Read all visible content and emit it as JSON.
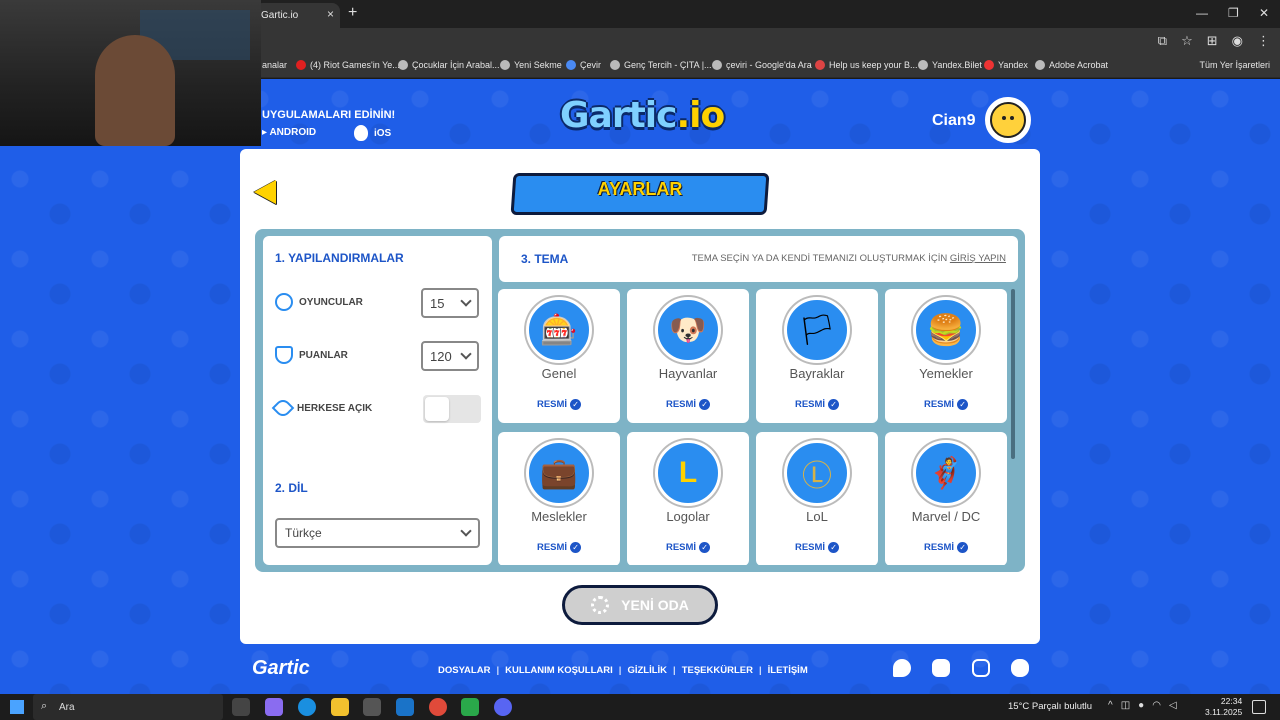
{
  "browser": {
    "tab_title": "Gartic.io",
    "tab_close": "×",
    "new_tab": "+",
    "window_controls": [
      "—",
      "❐",
      "✕"
    ],
    "bookmarks": [
      "analar",
      "(4) Riot Games'in Ye...",
      "Çocuklar İçin Arabal...",
      "Yeni Sekme",
      "Çevir",
      "Genç Tercih - ÇITA |...",
      "çeviri - Google'da Ara",
      "Help us keep your B...",
      "Yandex.Bilet",
      "Yandex",
      "Adobe Acrobat"
    ],
    "all_bookmarks": "Tüm Yer İşaretleri"
  },
  "header": {
    "apps_title": "UYGULAMALARI EDİNİN!",
    "android": "ANDROID",
    "ios": "iOS",
    "logo_main": "Gartic",
    "logo_io": ".io",
    "username": "Cian9"
  },
  "settings": {
    "title": "AYARLAR",
    "config_title": "1. YAPILANDIRMALAR",
    "players_label": "OYUNCULAR",
    "players_value": "15",
    "points_label": "PUANLAR",
    "points_value": "120",
    "public_label": "HERKESE AÇIK",
    "public_on": false,
    "language_title": "2. DİL",
    "language_value": "Türkçe",
    "theme_title": "3. TEMA",
    "theme_hint": "TEMA SEÇİN YA DA KENDİ TEMANIZI OLUŞTURMAK İÇİN ",
    "theme_hint_link": "GİRİŞ YAPIN",
    "themes": [
      {
        "name": "Genel",
        "badge": "RESMİ",
        "icon": "slot-machine-icon",
        "glyph": "🎰"
      },
      {
        "name": "Hayvanlar",
        "badge": "RESMİ",
        "icon": "dog-icon",
        "glyph": "🐶"
      },
      {
        "name": "Bayraklar",
        "badge": "RESMİ",
        "icon": "flag-icon",
        "glyph": "🏳"
      },
      {
        "name": "Yemekler",
        "badge": "RESMİ",
        "icon": "burger-icon",
        "glyph": "🍔"
      },
      {
        "name": "Meslekler",
        "badge": "RESMİ",
        "icon": "briefcase-icon",
        "glyph": "💼"
      },
      {
        "name": "Logolar",
        "badge": "RESMİ",
        "icon": "logo-icon",
        "glyph": "L"
      },
      {
        "name": "LoL",
        "badge": "RESMİ",
        "icon": "lol-icon",
        "glyph": "Ⓛ"
      },
      {
        "name": "Marvel / DC",
        "badge": "RESMİ",
        "icon": "hero-icon",
        "glyph": "🦸"
      }
    ],
    "new_room": "YENİ ODA"
  },
  "footer": {
    "logo": "Gartic",
    "links": [
      "DOSYALAR",
      "KULLANIM KOŞULLARI",
      "GİZLİLİK",
      "TEŞEKKÜRLER",
      "İLETİŞİM"
    ],
    "social": [
      "twitter-icon",
      "youtube-icon",
      "instagram-icon",
      "discord-icon"
    ]
  },
  "taskbar": {
    "search_placeholder": "Ara",
    "weather": "15°C  Parçalı bulutlu",
    "time": "22:34",
    "date": "3.11.2025"
  }
}
